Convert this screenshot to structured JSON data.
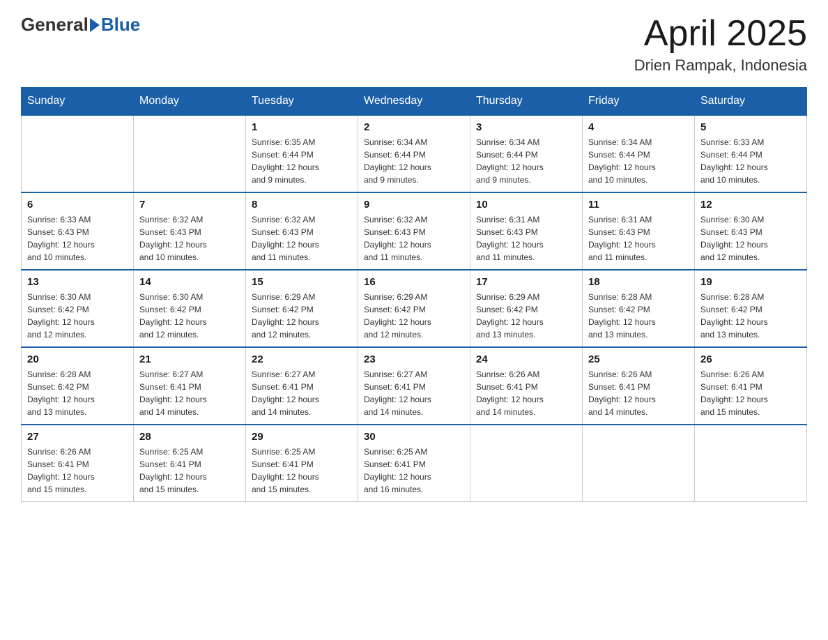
{
  "header": {
    "logo_general": "General",
    "logo_blue": "Blue",
    "title": "April 2025",
    "location": "Drien Rampak, Indonesia"
  },
  "days_of_week": [
    "Sunday",
    "Monday",
    "Tuesday",
    "Wednesday",
    "Thursday",
    "Friday",
    "Saturday"
  ],
  "weeks": [
    [
      {
        "day": "",
        "info": ""
      },
      {
        "day": "",
        "info": ""
      },
      {
        "day": "1",
        "info": "Sunrise: 6:35 AM\nSunset: 6:44 PM\nDaylight: 12 hours\nand 9 minutes."
      },
      {
        "day": "2",
        "info": "Sunrise: 6:34 AM\nSunset: 6:44 PM\nDaylight: 12 hours\nand 9 minutes."
      },
      {
        "day": "3",
        "info": "Sunrise: 6:34 AM\nSunset: 6:44 PM\nDaylight: 12 hours\nand 9 minutes."
      },
      {
        "day": "4",
        "info": "Sunrise: 6:34 AM\nSunset: 6:44 PM\nDaylight: 12 hours\nand 10 minutes."
      },
      {
        "day": "5",
        "info": "Sunrise: 6:33 AM\nSunset: 6:44 PM\nDaylight: 12 hours\nand 10 minutes."
      }
    ],
    [
      {
        "day": "6",
        "info": "Sunrise: 6:33 AM\nSunset: 6:43 PM\nDaylight: 12 hours\nand 10 minutes."
      },
      {
        "day": "7",
        "info": "Sunrise: 6:32 AM\nSunset: 6:43 PM\nDaylight: 12 hours\nand 10 minutes."
      },
      {
        "day": "8",
        "info": "Sunrise: 6:32 AM\nSunset: 6:43 PM\nDaylight: 12 hours\nand 11 minutes."
      },
      {
        "day": "9",
        "info": "Sunrise: 6:32 AM\nSunset: 6:43 PM\nDaylight: 12 hours\nand 11 minutes."
      },
      {
        "day": "10",
        "info": "Sunrise: 6:31 AM\nSunset: 6:43 PM\nDaylight: 12 hours\nand 11 minutes."
      },
      {
        "day": "11",
        "info": "Sunrise: 6:31 AM\nSunset: 6:43 PM\nDaylight: 12 hours\nand 11 minutes."
      },
      {
        "day": "12",
        "info": "Sunrise: 6:30 AM\nSunset: 6:43 PM\nDaylight: 12 hours\nand 12 minutes."
      }
    ],
    [
      {
        "day": "13",
        "info": "Sunrise: 6:30 AM\nSunset: 6:42 PM\nDaylight: 12 hours\nand 12 minutes."
      },
      {
        "day": "14",
        "info": "Sunrise: 6:30 AM\nSunset: 6:42 PM\nDaylight: 12 hours\nand 12 minutes."
      },
      {
        "day": "15",
        "info": "Sunrise: 6:29 AM\nSunset: 6:42 PM\nDaylight: 12 hours\nand 12 minutes."
      },
      {
        "day": "16",
        "info": "Sunrise: 6:29 AM\nSunset: 6:42 PM\nDaylight: 12 hours\nand 12 minutes."
      },
      {
        "day": "17",
        "info": "Sunrise: 6:29 AM\nSunset: 6:42 PM\nDaylight: 12 hours\nand 13 minutes."
      },
      {
        "day": "18",
        "info": "Sunrise: 6:28 AM\nSunset: 6:42 PM\nDaylight: 12 hours\nand 13 minutes."
      },
      {
        "day": "19",
        "info": "Sunrise: 6:28 AM\nSunset: 6:42 PM\nDaylight: 12 hours\nand 13 minutes."
      }
    ],
    [
      {
        "day": "20",
        "info": "Sunrise: 6:28 AM\nSunset: 6:42 PM\nDaylight: 12 hours\nand 13 minutes."
      },
      {
        "day": "21",
        "info": "Sunrise: 6:27 AM\nSunset: 6:41 PM\nDaylight: 12 hours\nand 14 minutes."
      },
      {
        "day": "22",
        "info": "Sunrise: 6:27 AM\nSunset: 6:41 PM\nDaylight: 12 hours\nand 14 minutes."
      },
      {
        "day": "23",
        "info": "Sunrise: 6:27 AM\nSunset: 6:41 PM\nDaylight: 12 hours\nand 14 minutes."
      },
      {
        "day": "24",
        "info": "Sunrise: 6:26 AM\nSunset: 6:41 PM\nDaylight: 12 hours\nand 14 minutes."
      },
      {
        "day": "25",
        "info": "Sunrise: 6:26 AM\nSunset: 6:41 PM\nDaylight: 12 hours\nand 14 minutes."
      },
      {
        "day": "26",
        "info": "Sunrise: 6:26 AM\nSunset: 6:41 PM\nDaylight: 12 hours\nand 15 minutes."
      }
    ],
    [
      {
        "day": "27",
        "info": "Sunrise: 6:26 AM\nSunset: 6:41 PM\nDaylight: 12 hours\nand 15 minutes."
      },
      {
        "day": "28",
        "info": "Sunrise: 6:25 AM\nSunset: 6:41 PM\nDaylight: 12 hours\nand 15 minutes."
      },
      {
        "day": "29",
        "info": "Sunrise: 6:25 AM\nSunset: 6:41 PM\nDaylight: 12 hours\nand 15 minutes."
      },
      {
        "day": "30",
        "info": "Sunrise: 6:25 AM\nSunset: 6:41 PM\nDaylight: 12 hours\nand 16 minutes."
      },
      {
        "day": "",
        "info": ""
      },
      {
        "day": "",
        "info": ""
      },
      {
        "day": "",
        "info": ""
      }
    ]
  ]
}
